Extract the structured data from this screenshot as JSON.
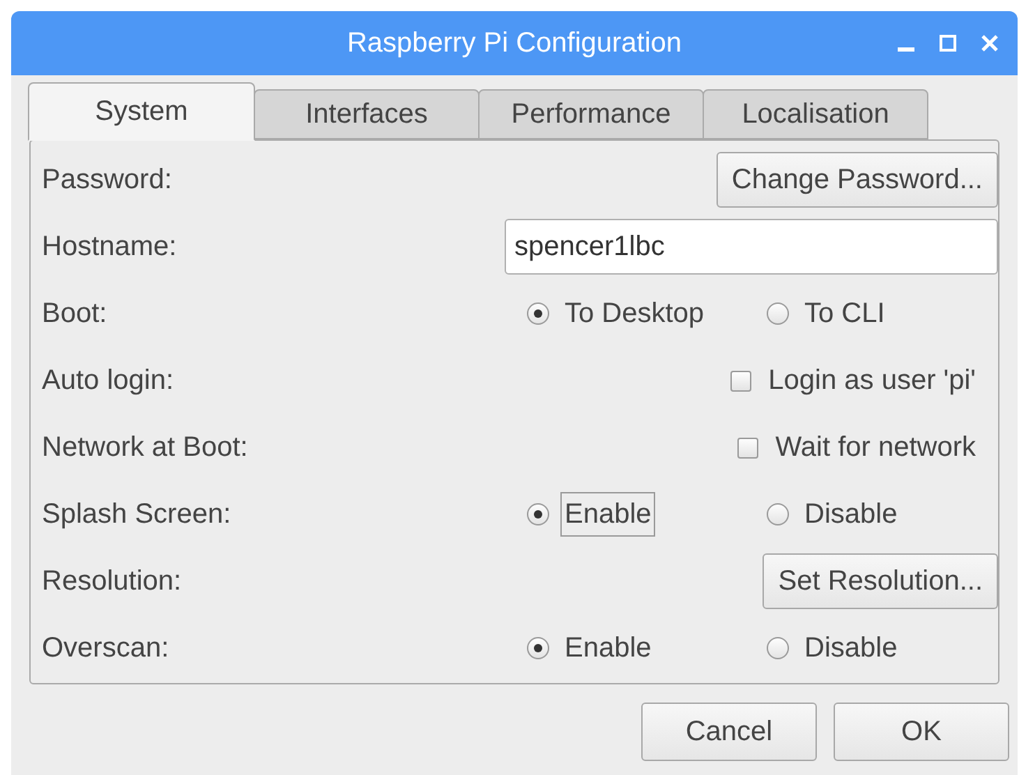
{
  "window": {
    "title": "Raspberry Pi Configuration"
  },
  "tabs": [
    {
      "label": "System",
      "selected": true
    },
    {
      "label": "Interfaces",
      "selected": false
    },
    {
      "label": "Performance",
      "selected": false
    },
    {
      "label": "Localisation",
      "selected": false
    }
  ],
  "rows": [
    {
      "kind": "button",
      "label": "Password:",
      "button": "Change Password..."
    },
    {
      "kind": "field",
      "label": "Hostname:",
      "value": "spencer1lbc"
    },
    {
      "kind": "radio",
      "label": "Boot:",
      "options": [
        {
          "label": "To Desktop",
          "selected": true,
          "focused": false
        },
        {
          "label": "To CLI",
          "selected": false,
          "focused": false
        }
      ]
    },
    {
      "kind": "checkbox",
      "label": "Auto login:",
      "option": "Login as user 'pi'",
      "checked": false
    },
    {
      "kind": "checkbox",
      "label": "Network at Boot:",
      "option": "Wait for network",
      "checked": false
    },
    {
      "kind": "radio",
      "label": "Splash Screen:",
      "options": [
        {
          "label": "Enable",
          "selected": true,
          "focused": true
        },
        {
          "label": "Disable",
          "selected": false,
          "focused": false
        }
      ]
    },
    {
      "kind": "button",
      "label": "Resolution:",
      "button": "Set Resolution..."
    },
    {
      "kind": "radio",
      "label": "Overscan:",
      "options": [
        {
          "label": "Enable",
          "selected": true,
          "focused": false
        },
        {
          "label": "Disable",
          "selected": false,
          "focused": false
        }
      ]
    }
  ],
  "buttons": [
    "Cancel",
    "OK"
  ]
}
